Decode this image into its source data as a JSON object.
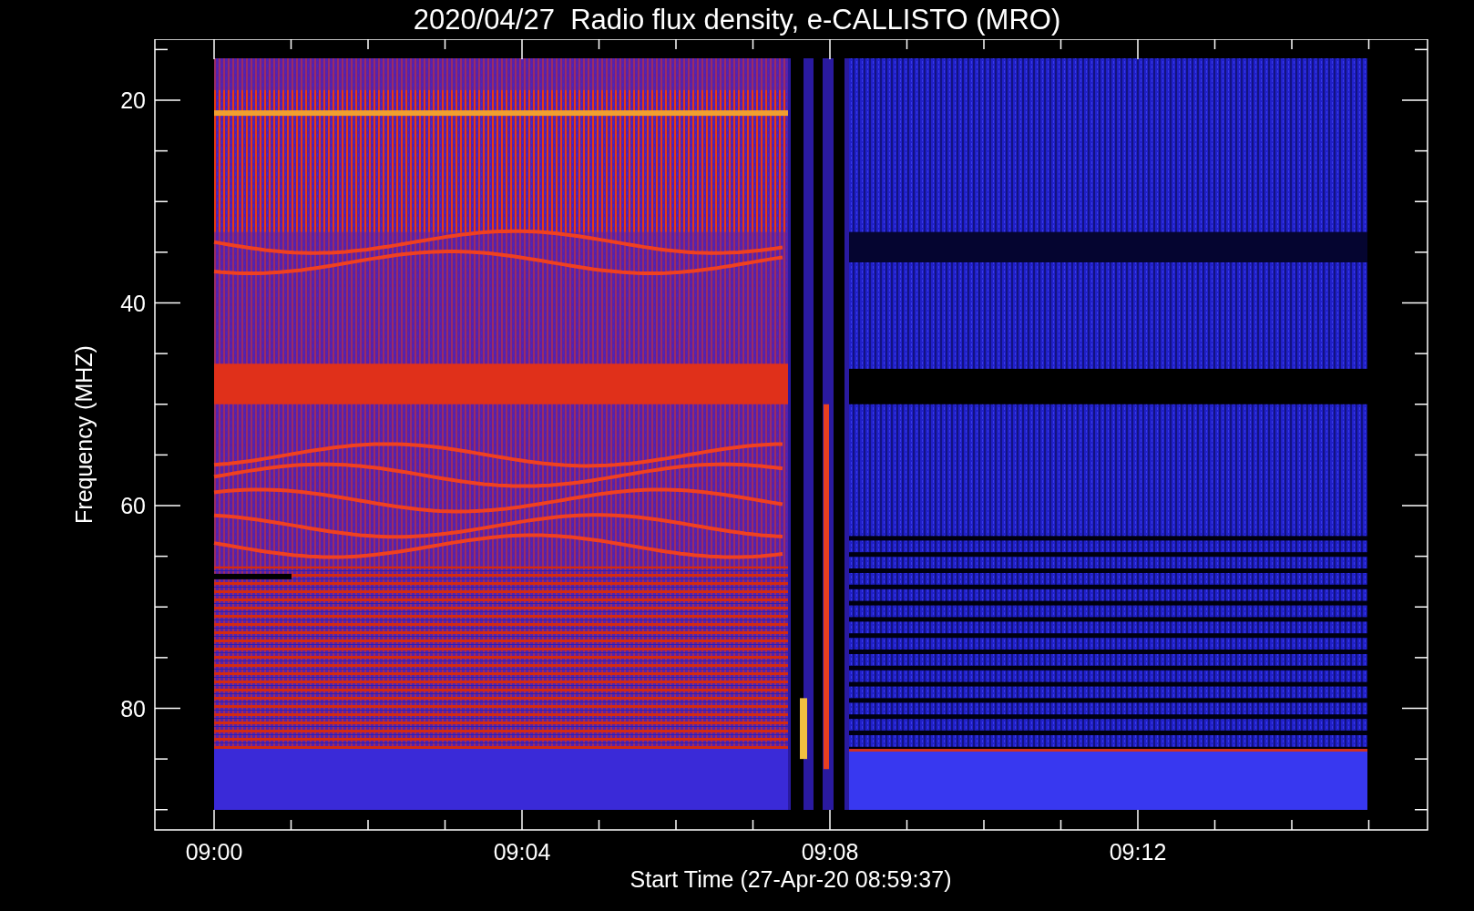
{
  "title": "2020/04/27  Radio flux density, e-CALLISTO (MRO)",
  "plot": {
    "xlabel": "Start Time (27-Apr-20 08:59:37)",
    "ylabel": "Frequency (MHZ)",
    "xticks": [
      "09:00",
      "09:04",
      "09:08",
      "09:12"
    ],
    "yticks": [
      "20",
      "40",
      "60",
      "80"
    ]
  }
}
